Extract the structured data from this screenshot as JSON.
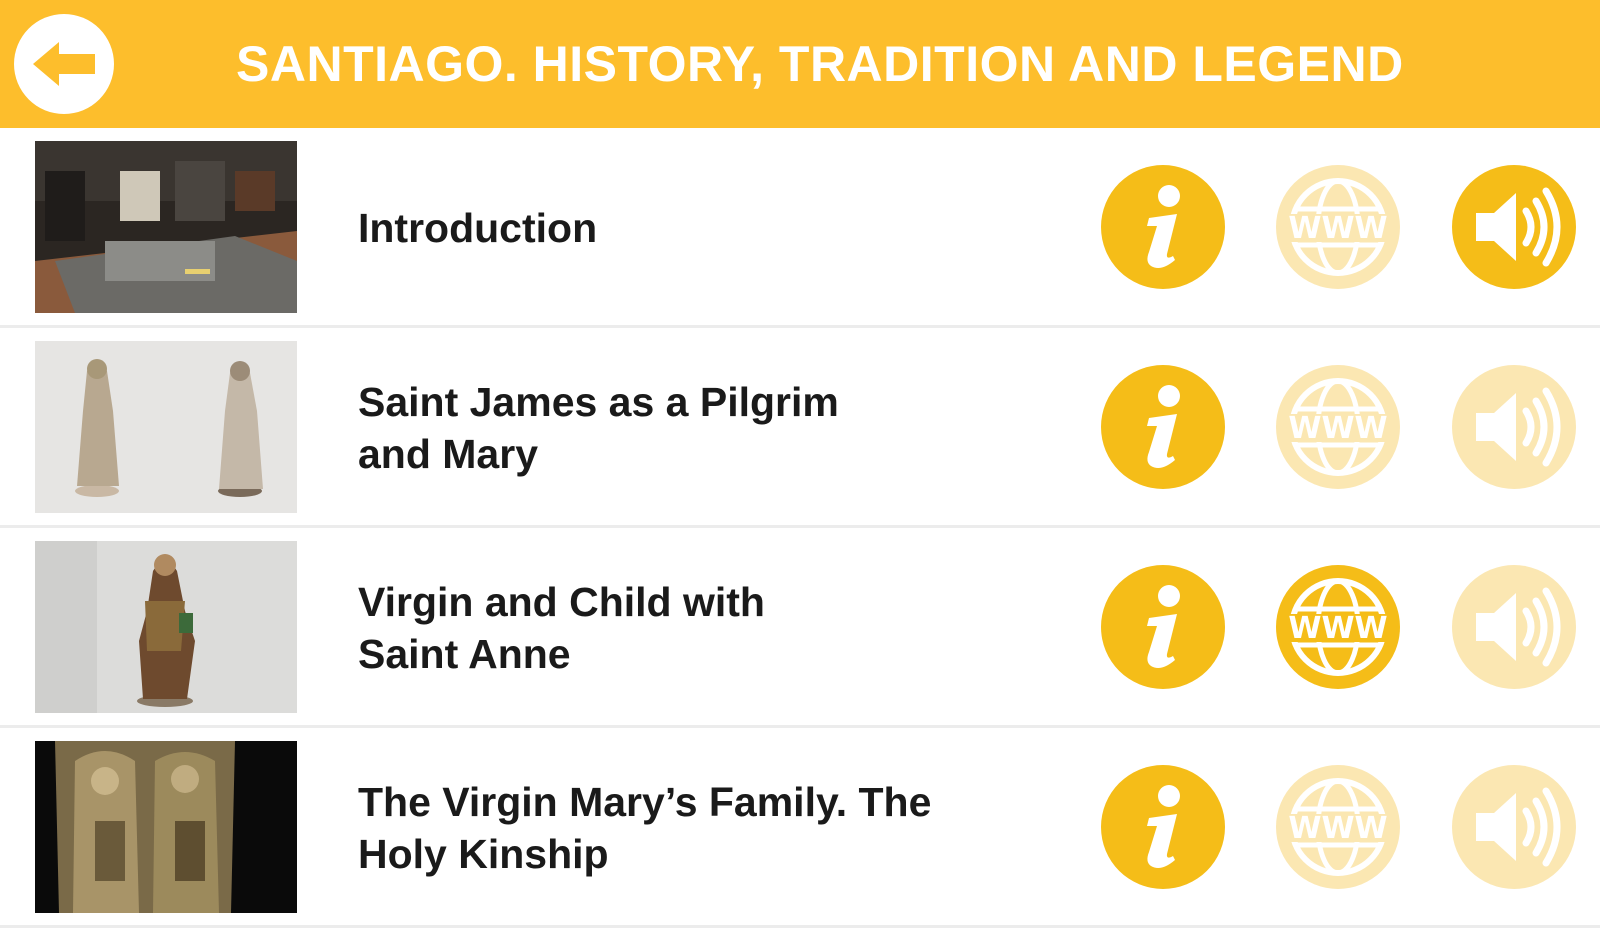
{
  "header": {
    "title": "SANTIAGO. HISTORY, TRADITION AND LEGEND",
    "color": "#FDBE2C"
  },
  "colors": {
    "active_icon": "#F5BD18",
    "inactive_icon": "#FBE7B2"
  },
  "icons": {
    "back": "back-arrow-icon",
    "info": "info-icon",
    "web": "www-globe-icon",
    "audio": "speaker-icon"
  },
  "items": [
    {
      "title": "Introduction",
      "thumbnail": "exhibition-hall-photo",
      "info_enabled": true,
      "web_enabled": false,
      "audio_enabled": true
    },
    {
      "title": "Saint James as a Pilgrim\nand Mary",
      "thumbnail": "two-statues-photo",
      "info_enabled": true,
      "web_enabled": false,
      "audio_enabled": false
    },
    {
      "title": "Virgin and Child with\nSaint Anne",
      "thumbnail": "statue-photo",
      "info_enabled": true,
      "web_enabled": true,
      "audio_enabled": false
    },
    {
      "title": "The Virgin Mary’s Family. The\nHoly Kinship",
      "thumbnail": "relief-carving-photo",
      "info_enabled": true,
      "web_enabled": false,
      "audio_enabled": false
    }
  ]
}
